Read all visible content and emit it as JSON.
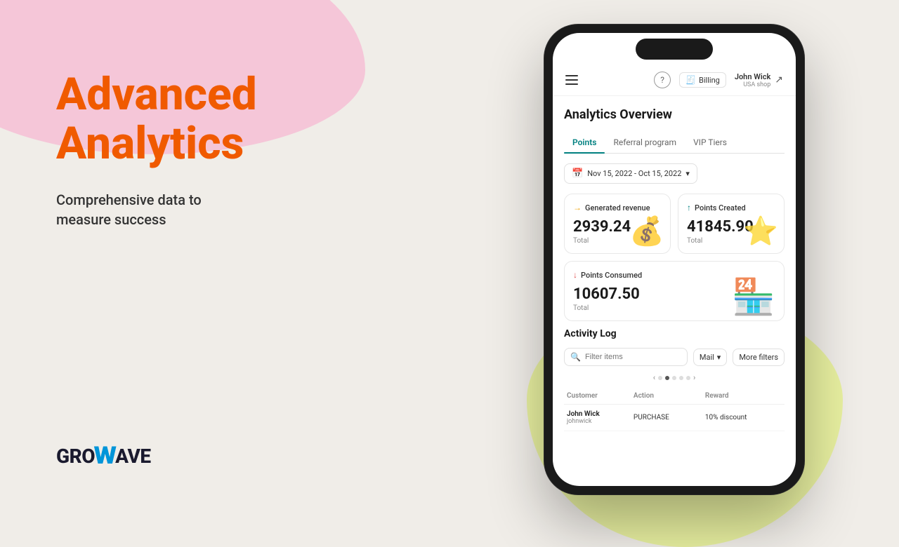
{
  "background": {
    "blob_pink_color": "#f5c6d8",
    "blob_yellow_color": "#e8f0a0"
  },
  "left": {
    "headline_line1": "Advanced",
    "headline_line2": "Analytics",
    "subtext": "Comprehensive data to\nmeasure success",
    "logo_prefix": "GRO",
    "logo_wave": "W",
    "logo_suffix": "AVE"
  },
  "phone": {
    "topbar": {
      "help_label": "?",
      "billing_label": "Billing",
      "user_name": "John Wick",
      "user_shop": "USA shop"
    },
    "analytics": {
      "title": "Analytics Overview",
      "tabs": [
        {
          "label": "Points",
          "active": true
        },
        {
          "label": "Referral program",
          "active": false
        },
        {
          "label": "VIP Tiers",
          "active": false
        }
      ],
      "date_range": "Nov 15, 2022 - Oct 15, 2022",
      "stats": [
        {
          "label": "Generated revenue",
          "arrow": "right",
          "value": "2939.24",
          "sub": "Total",
          "bg_icon": "💰"
        },
        {
          "label": "Points Created",
          "arrow": "up",
          "value": "41845.90",
          "sub": "Total",
          "bg_icon": "⭐"
        },
        {
          "label": "Points Consumed",
          "arrow": "down",
          "value": "10607.50",
          "sub": "Total",
          "bg_icon": "🏪",
          "full_width": true
        }
      ]
    },
    "activity_log": {
      "title": "Activity Log",
      "search_placeholder": "Filter items",
      "mail_filter": "Mail",
      "more_filters": "More filters",
      "columns": [
        "Customer",
        "Action",
        "Reward"
      ],
      "rows": [
        {
          "customer_name": "John Wick",
          "customer_email": "johnwick",
          "action": "PURCHASE",
          "reward": "10% discount"
        }
      ]
    }
  }
}
